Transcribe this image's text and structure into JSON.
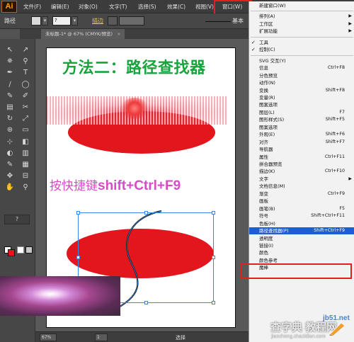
{
  "menubar": {
    "logo": "Ai",
    "items": [
      "文件(F)",
      "编辑(E)",
      "对象(O)",
      "文字(T)",
      "选择(S)",
      "效果(C)",
      "视图(V)",
      "窗口(W)"
    ]
  },
  "controlbar": {
    "path_label": "路径",
    "q_label": "?",
    "stroke_label": "描边",
    "stroke_value": "基本"
  },
  "tabs": {
    "document": "未标题-1* @ 67% (CMYK/预览)",
    "close": "×"
  },
  "tools": {
    "icons": [
      "↖",
      "↗",
      "✵",
      "⚲",
      "✒",
      "T",
      "∕",
      "◯",
      "✎",
      "✐",
      "▤",
      "✂",
      "↻",
      "⤢",
      "⊛",
      "▭",
      "⊹",
      "◧",
      "◐",
      "▥",
      "✎",
      "▦",
      "✥",
      "⊟",
      "✋",
      "⚲"
    ],
    "help": "?"
  },
  "artboard": {
    "title": "方法二：路径查找器",
    "shortcut_prefix": "按快捷键",
    "shortcut_keys": "shift+Ctrl+F9"
  },
  "statusbar": {
    "zoom": "67%",
    "page": "1",
    "tool": "选择"
  },
  "window_menu": {
    "items": [
      {
        "label": "新建窗口(W)",
        "shortcut": "",
        "arrow": false,
        "check": false
      },
      {
        "label": "排列(A)",
        "shortcut": "",
        "arrow": true,
        "check": false
      },
      {
        "label": "工作区",
        "shortcut": "",
        "arrow": true,
        "check": false
      },
      {
        "label": "扩展功能",
        "shortcut": "",
        "arrow": true,
        "check": false
      },
      {
        "label": "工具",
        "shortcut": "",
        "arrow": false,
        "check": true
      },
      {
        "label": "控制(C)",
        "shortcut": "",
        "arrow": false,
        "check": true
      },
      {
        "label": "SVG 交互(Y)",
        "shortcut": "",
        "arrow": false,
        "check": false
      },
      {
        "label": "信息",
        "shortcut": "Ctrl+F8",
        "arrow": false,
        "check": false
      },
      {
        "label": "分色预览",
        "shortcut": "",
        "arrow": false,
        "check": false
      },
      {
        "label": "动作(N)",
        "shortcut": "",
        "arrow": false,
        "check": false
      },
      {
        "label": "变换",
        "shortcut": "Shift+F8",
        "arrow": false,
        "check": false
      },
      {
        "label": "变量(R)",
        "shortcut": "",
        "arrow": false,
        "check": false
      },
      {
        "label": "图案选项",
        "shortcut": "",
        "arrow": false,
        "check": false
      },
      {
        "label": "图层(L)",
        "shortcut": "F7",
        "arrow": false,
        "check": false
      },
      {
        "label": "图形样式(S)",
        "shortcut": "Shift+F5",
        "arrow": false,
        "check": false
      },
      {
        "label": "图案选项",
        "shortcut": "",
        "arrow": false,
        "check": false
      },
      {
        "label": "外观(E)",
        "shortcut": "Shift+F6",
        "arrow": false,
        "check": false
      },
      {
        "label": "对齐",
        "shortcut": "Shift+F7",
        "arrow": false,
        "check": false
      },
      {
        "label": "导航器",
        "shortcut": "",
        "arrow": false,
        "check": false
      },
      {
        "label": "属性",
        "shortcut": "Ctrl+F11",
        "arrow": false,
        "check": false
      },
      {
        "label": "拼合器预览",
        "shortcut": "",
        "arrow": false,
        "check": false
      },
      {
        "label": "描边(K)",
        "shortcut": "Ctrl+F10",
        "arrow": false,
        "check": false
      },
      {
        "label": "文字",
        "shortcut": "",
        "arrow": true,
        "check": false
      },
      {
        "label": "文档信息(M)",
        "shortcut": "",
        "arrow": false,
        "check": false
      },
      {
        "label": "渐变",
        "shortcut": "Ctrl+F9",
        "arrow": false,
        "check": false
      },
      {
        "label": "画板",
        "shortcut": "",
        "arrow": false,
        "check": false
      },
      {
        "label": "画笔(B)",
        "shortcut": "F5",
        "arrow": false,
        "check": false
      },
      {
        "label": "符号",
        "shortcut": "Shift+Ctrl+F11",
        "arrow": false,
        "check": false
      },
      {
        "label": "色板(H)",
        "shortcut": "",
        "arrow": false,
        "check": false
      },
      {
        "label": "路径查找器(P)",
        "shortcut": "Shift+Ctrl+F9",
        "arrow": false,
        "check": false,
        "highlight": true
      },
      {
        "label": "透明度",
        "shortcut": "",
        "arrow": false,
        "check": false
      },
      {
        "label": "链接(I)",
        "shortcut": "",
        "arrow": false,
        "check": false
      },
      {
        "label": "颜色",
        "shortcut": "",
        "arrow": false,
        "check": false
      },
      {
        "label": "颜色参考",
        "shortcut": "",
        "arrow": false,
        "check": false
      },
      {
        "label": "魔棒",
        "shortcut": "",
        "arrow": false,
        "check": false
      }
    ]
  },
  "watermark": {
    "site": "jb51.net",
    "big": "查字典 教程网",
    "url": "jiaocheng.chazidian.com"
  },
  "colors": {
    "title_green": "#17a43c",
    "shortcut_magenta": "#d64cc8",
    "ellipse_red": "#e3151d",
    "menu_highlight": "#1d5fd0",
    "callout_red": "#e02020"
  }
}
